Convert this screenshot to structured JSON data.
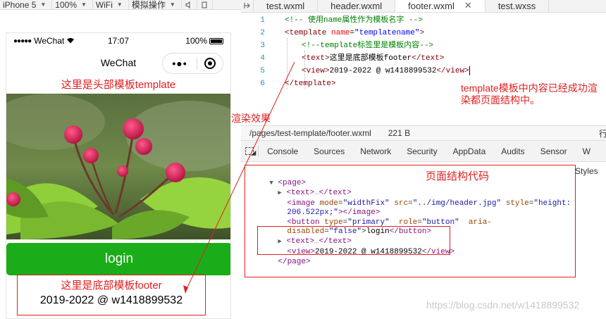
{
  "simulator_toolbar": {
    "device": "iPhone 5",
    "zoom": "100%",
    "network": "WiFi",
    "operations": "模拟操作"
  },
  "phone": {
    "status": {
      "signal": "●●●●●",
      "carrier": "WeChat",
      "time": "17:07",
      "battery": "100%"
    },
    "nav_title": "WeChat",
    "capsule_dots": "•●•",
    "header_annotation": "这里是头部模板template",
    "login_button": "login",
    "footer_annotation": "这里是底部模板footer",
    "footer_copyright": "2019-2022 @ w1418899532"
  },
  "editor": {
    "tabs": [
      {
        "label": "test.wxml",
        "active": false
      },
      {
        "label": "header.wxml",
        "active": false
      },
      {
        "label": "footer.wxml",
        "active": true
      },
      {
        "label": "test.wxss",
        "active": false
      }
    ],
    "close_glyph": "✕",
    "lines": [
      {
        "n": "1",
        "comment": "<!-- 使用name属性作为模板名字 -->"
      },
      {
        "n": "2",
        "open": "<template ",
        "attr": "name",
        "eq": "=",
        "value": "\"templatename\"",
        "close": ">"
      },
      {
        "n": "3",
        "comment": "<!--template标签里是模板内容-->"
      },
      {
        "n": "4",
        "open": "<text>",
        "text": "这里是底部模板footer",
        "close": "</text>"
      },
      {
        "n": "5",
        "open": "<view>",
        "text": "2019-2022 @ w1418899532",
        "close": "</view>"
      },
      {
        "n": "6",
        "open": "</template>"
      }
    ],
    "note": "template模板中内容已经成功渲染都页面结构中。"
  },
  "file_bar": {
    "path": "/pages/test-template/footer.wxml",
    "size": "221 B",
    "more": "行"
  },
  "devtools": {
    "tabs": [
      "Console",
      "Sources",
      "Network",
      "Security",
      "AppData",
      "Audits",
      "Sensor",
      "W"
    ],
    "styles_tab": "Styles",
    "structure_label": "页面结构代码",
    "dom": {
      "page_open": "<page>",
      "text_open": "<text>",
      "ellipsis": "…",
      "text_close": "</text>",
      "image_tag": "<image ",
      "image_attr1": "mode",
      "image_val1": "\"widthFix\"",
      "image_attr2": "src",
      "image_val2": "\"../img/header.jpg\"",
      "image_attr3": "style",
      "image_val3": "\"height:",
      "image_val3b": "206.522px;\"",
      "image_close": "></image>",
      "button_tag": "<button ",
      "button_attr1": "type",
      "button_val1": "\"primary\"",
      "button_attr2": "role",
      "button_val2": "\"button\"",
      "button_attr3": "aria-",
      "button_attr3b": "disabled",
      "button_val3": "\"false\"",
      "button_text": "login",
      "button_close": "</button>",
      "view_open": "<view>",
      "view_text": "2019-2022 @ w1418899532",
      "view_close": "</view>",
      "page_close": "</page>"
    }
  },
  "annotations": {
    "render_effect": "渲染效果",
    "watermark": "https://blog.csdn.net/w1418899532"
  },
  "colors": {
    "annotation_red": "#e02020",
    "login_green": "#1aad19"
  }
}
